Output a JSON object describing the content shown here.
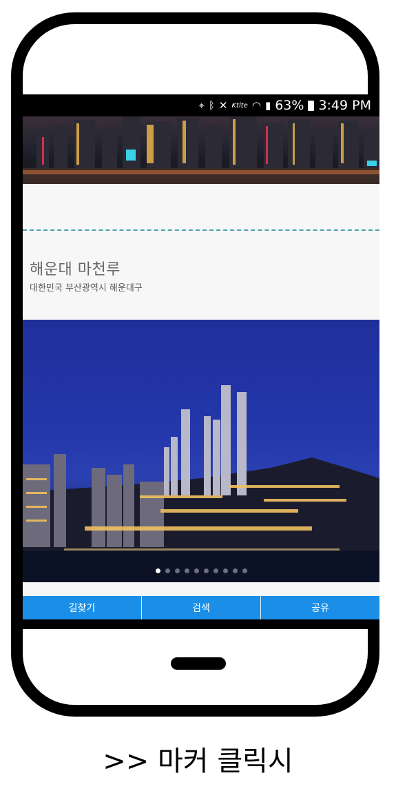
{
  "status_bar": {
    "battery": "63%",
    "time": "3:49 PM",
    "lte": "Ktlte"
  },
  "place": {
    "name": "해운대 마천루",
    "address": "대한민국 부산광역시 해운대구"
  },
  "carousel": {
    "total_dots": 10,
    "active_index": 0
  },
  "buttons": {
    "directions": "길찾기",
    "search": "검색",
    "share": "공유"
  },
  "caption": ">> 마커 클릭시",
  "colors": {
    "accent_blue": "#1b8fe8",
    "divider": "#48a0b4"
  }
}
